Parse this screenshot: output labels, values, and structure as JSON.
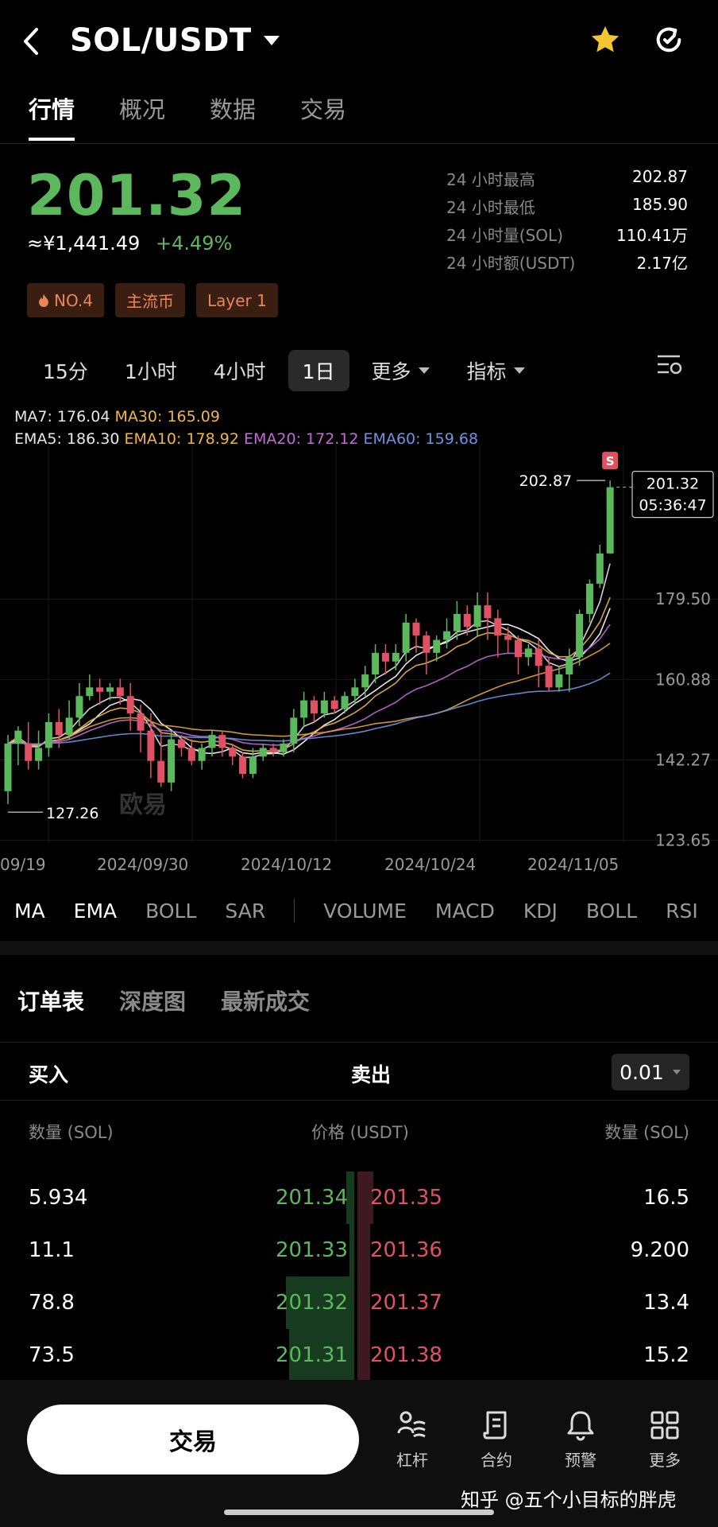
{
  "header": {
    "pair": "SOL/USDT"
  },
  "tabs": [
    "行情",
    "概况",
    "数据",
    "交易"
  ],
  "price": {
    "last": "201.32",
    "cny": "≈¥1,441.49",
    "change": "+4.49%"
  },
  "stats": [
    {
      "label": "24 小时最高",
      "value": "202.87"
    },
    {
      "label": "24 小时最低",
      "value": "185.90"
    },
    {
      "label": "24 小时量(SOL)",
      "value": "110.41万"
    },
    {
      "label": "24 小时额(USDT)",
      "value": "2.17亿"
    }
  ],
  "badges": {
    "rank": "NO.4",
    "b2": "主流币",
    "b3": "Layer 1"
  },
  "timeframes": {
    "t1": "15分",
    "t2": "1小时",
    "t3": "4小时",
    "t4": "1日",
    "more": "更多",
    "indicator": "指标"
  },
  "ma_legend": {
    "ma7": "MA7: 176.04",
    "ma30": "MA30: 165.09",
    "ema5": "EMA5: 186.30",
    "ema10": "EMA10: 178.92",
    "ema20": "EMA20: 172.12",
    "ema60": "EMA60: 159.68"
  },
  "chart_data": {
    "type": "candlestick",
    "y_ticks": [
      "179.50",
      "160.88",
      "142.27",
      "123.65"
    ],
    "x_ticks": [
      "09/19",
      "2024/09/30",
      "2024/10/12",
      "2024/10/24",
      "2024/11/05"
    ],
    "high_label": "202.87",
    "low_label": "127.26",
    "current_price": "201.32",
    "countdown": "05:36:47",
    "signal_marker": "S",
    "watermark": "欧易",
    "ylim": [
      119,
      211
    ],
    "candles": [
      [
        131,
        142,
        128,
        144
      ],
      [
        142,
        145,
        137,
        146
      ],
      [
        142,
        138,
        136,
        147
      ],
      [
        138,
        141,
        136,
        145
      ],
      [
        141,
        147,
        139,
        149
      ],
      [
        147,
        144,
        141,
        150
      ],
      [
        144,
        148,
        143,
        152
      ],
      [
        148,
        153,
        146,
        156
      ],
      [
        153,
        155,
        152,
        158
      ],
      [
        155,
        154,
        151,
        157
      ],
      [
        154,
        155,
        152,
        156
      ],
      [
        155,
        153,
        151,
        157
      ],
      [
        153,
        149,
        145,
        156
      ],
      [
        149,
        145,
        140,
        151
      ],
      [
        145,
        138,
        134,
        149
      ],
      [
        138,
        133,
        132,
        145
      ],
      [
        133,
        143,
        131,
        145
      ],
      [
        143,
        141,
        139,
        144
      ],
      [
        141,
        138,
        137,
        143
      ],
      [
        138,
        141,
        136,
        142
      ],
      [
        141,
        144,
        139,
        145
      ],
      [
        144,
        141,
        139,
        145
      ],
      [
        141,
        139,
        137,
        142
      ],
      [
        139,
        135,
        134,
        140
      ],
      [
        135,
        139,
        134,
        141
      ],
      [
        139,
        141,
        138,
        142
      ],
      [
        141,
        140,
        139,
        142
      ],
      [
        140,
        142,
        139,
        143
      ],
      [
        142,
        148,
        140,
        150
      ],
      [
        148,
        152,
        146,
        154
      ],
      [
        152,
        149,
        147,
        153
      ],
      [
        149,
        152,
        148,
        154
      ],
      [
        152,
        150,
        149,
        153
      ],
      [
        150,
        153,
        149,
        154
      ],
      [
        153,
        155,
        151,
        157
      ],
      [
        155,
        158,
        153,
        160
      ],
      [
        158,
        163,
        156,
        165
      ],
      [
        163,
        161,
        158,
        165
      ],
      [
        161,
        163,
        159,
        165
      ],
      [
        163,
        170,
        161,
        172
      ],
      [
        170,
        167,
        163,
        171
      ],
      [
        167,
        163,
        158,
        168
      ],
      [
        163,
        166,
        161,
        167
      ],
      [
        166,
        168,
        164,
        171
      ],
      [
        168,
        172,
        166,
        175
      ],
      [
        172,
        169,
        167,
        174
      ],
      [
        169,
        174,
        167,
        177
      ],
      [
        174,
        171,
        166,
        177
      ],
      [
        171,
        167,
        162,
        173
      ],
      [
        167,
        166,
        163,
        169
      ],
      [
        166,
        162,
        158,
        167
      ],
      [
        162,
        164,
        160,
        165
      ],
      [
        164,
        160,
        155,
        166
      ],
      [
        160,
        155,
        154,
        162
      ],
      [
        155,
        158,
        154,
        160
      ],
      [
        158,
        162,
        154,
        164
      ],
      [
        162,
        172,
        160,
        173
      ],
      [
        172,
        179,
        170,
        180
      ],
      [
        179,
        186,
        178,
        188
      ],
      [
        186,
        201.32,
        185.9,
        202.87
      ]
    ]
  },
  "indicators": {
    "main": [
      "MA",
      "EMA",
      "BOLL",
      "SAR"
    ],
    "sub": [
      "VOLUME",
      "MACD",
      "KDJ",
      "BOLL",
      "RSI"
    ]
  },
  "orderbook": {
    "tabs": [
      "订单表",
      "深度图",
      "最新成交"
    ],
    "buy_label": "买入",
    "sell_label": "卖出",
    "step": "0.01",
    "col_qty_left": "数量 (SOL)",
    "col_price": "价格 (USDT)",
    "col_qty_right": "数量 (SOL)",
    "rows": [
      {
        "bid_qty": "5.934",
        "bid": "201.34",
        "ask": "201.35",
        "ask_qty": "16.5"
      },
      {
        "bid_qty": "11.1",
        "bid": "201.33",
        "ask": "201.36",
        "ask_qty": "9.200"
      },
      {
        "bid_qty": "78.8",
        "bid": "201.32",
        "ask": "201.37",
        "ask_qty": "13.4"
      },
      {
        "bid_qty": "73.5",
        "bid": "201.31",
        "ask": "201.38",
        "ask_qty": "15.2"
      }
    ]
  },
  "bottom": {
    "trade": "交易",
    "lever": "杠杆",
    "contract": "合约",
    "alert": "预警",
    "more": "更多",
    "watermark": "知乎 @五个小目标的胖虎"
  }
}
